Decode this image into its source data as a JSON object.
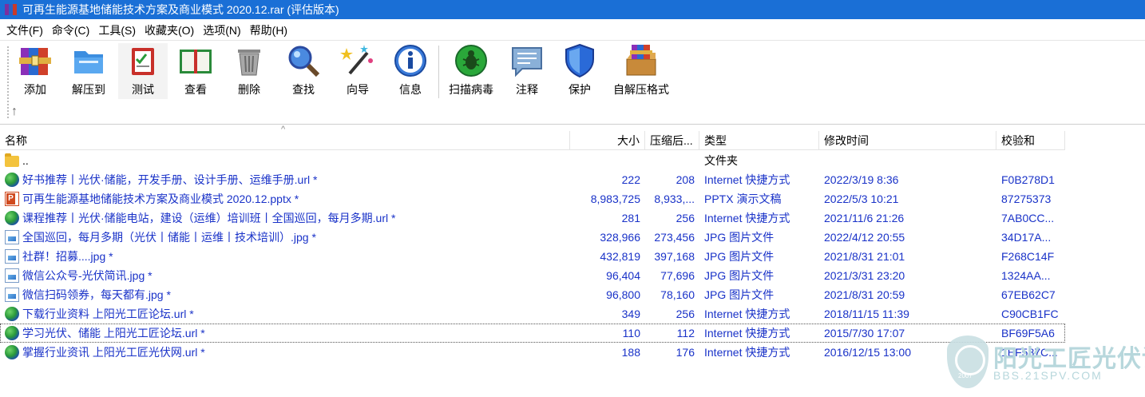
{
  "window": {
    "title": "可再生能源基地储能技术方案及商业模式 2020.12.rar (评估版本)"
  },
  "menu": [
    {
      "label": "文件(F)"
    },
    {
      "label": "命令(C)"
    },
    {
      "label": "工具(S)"
    },
    {
      "label": "收藏夹(O)"
    },
    {
      "label": "选项(N)"
    },
    {
      "label": "帮助(H)"
    }
  ],
  "toolbar": {
    "buttons": [
      {
        "label": "添加",
        "icon": "add-archive-icon"
      },
      {
        "label": "解压到",
        "icon": "extract-folder-icon"
      },
      {
        "label": "测试",
        "icon": "test-clipboard-icon"
      },
      {
        "label": "查看",
        "icon": "view-book-icon"
      },
      {
        "label": "删除",
        "icon": "trash-bin-icon"
      },
      {
        "label": "查找",
        "icon": "search-magnifier-icon"
      },
      {
        "label": "向导",
        "icon": "wizard-wand-icon"
      },
      {
        "label": "信息",
        "icon": "info-icon"
      },
      {
        "label": "扫描病毒",
        "icon": "virus-scan-icon"
      },
      {
        "label": "注释",
        "icon": "comment-icon"
      },
      {
        "label": "保护",
        "icon": "shield-protect-icon"
      },
      {
        "label": "自解压格式",
        "icon": "sfx-box-icon"
      }
    ],
    "up_arrow": "↑"
  },
  "columns": {
    "name": "名称",
    "size": "大小",
    "packed": "压缩后...",
    "type": "类型",
    "modified": "修改时间",
    "crc": "校验和"
  },
  "sort_indicator": "^",
  "files": [
    {
      "name": "..",
      "size": "",
      "packed": "",
      "type": "文件夹",
      "modified": "",
      "crc": "",
      "icon": "folder"
    },
    {
      "name": "好书推荐丨光伏·储能，开发手册、设计手册、运维手册.url *",
      "size": "222",
      "packed": "208",
      "type": "Internet 快捷方式",
      "modified": "2022/3/19 8:36",
      "crc": "F0B278D1",
      "icon": "globe"
    },
    {
      "name": "可再生能源基地储能技术方案及商业模式 2020.12.pptx *",
      "size": "8,983,725",
      "packed": "8,933,...",
      "type": "PPTX 演示文稿",
      "modified": "2022/5/3 10:21",
      "crc": "87275373",
      "icon": "ppt"
    },
    {
      "name": "课程推荐丨光伏·储能电站，建设（运维）培训班丨全国巡回，每月多期.url *",
      "size": "281",
      "packed": "256",
      "type": "Internet 快捷方式",
      "modified": "2021/11/6 21:26",
      "crc": "7AB0CC...",
      "icon": "globe"
    },
    {
      "name": "全国巡回，每月多期（光伏丨储能丨运维丨技术培训）.jpg *",
      "size": "328,966",
      "packed": "273,456",
      "type": "JPG 图片文件",
      "modified": "2022/4/12 20:55",
      "crc": "34D17A...",
      "icon": "jpg"
    },
    {
      "name": "社群！招募....jpg *",
      "size": "432,819",
      "packed": "397,168",
      "type": "JPG 图片文件",
      "modified": "2021/8/31 21:01",
      "crc": "F268C14F",
      "icon": "jpg"
    },
    {
      "name": "微信公众号-光伏简讯.jpg *",
      "size": "96,404",
      "packed": "77,696",
      "type": "JPG 图片文件",
      "modified": "2021/3/31 23:20",
      "crc": "1324AA...",
      "icon": "jpg"
    },
    {
      "name": "微信扫码领券，每天都有.jpg *",
      "size": "96,800",
      "packed": "78,160",
      "type": "JPG 图片文件",
      "modified": "2021/8/31 20:59",
      "crc": "67EB62C7",
      "icon": "jpg"
    },
    {
      "name": "下载行业资料 上阳光工匠论坛.url *",
      "size": "349",
      "packed": "256",
      "type": "Internet 快捷方式",
      "modified": "2018/11/15 11:39",
      "crc": "C90CB1FC",
      "icon": "globe"
    },
    {
      "name": "学习光伏、储能 上阳光工匠论坛.url *",
      "size": "110",
      "packed": "112",
      "type": "Internet 快捷方式",
      "modified": "2015/7/30 17:07",
      "crc": "BF69F5A6",
      "icon": "globe",
      "focused": true
    },
    {
      "name": "掌握行业资讯 上阳光工匠光伏网.url *",
      "size": "188",
      "packed": "176",
      "type": "Internet 快捷方式",
      "modified": "2016/12/15 13:00",
      "crc": "1EF587C...",
      "icon": "globe"
    }
  ],
  "watermark": {
    "title": "阳光工匠光伏论坛",
    "url": "BBS.21SPV.COM",
    "badge_year": "2007"
  },
  "colors": {
    "titlebar": "#1a6fd6",
    "row_text": "#1932c8"
  }
}
